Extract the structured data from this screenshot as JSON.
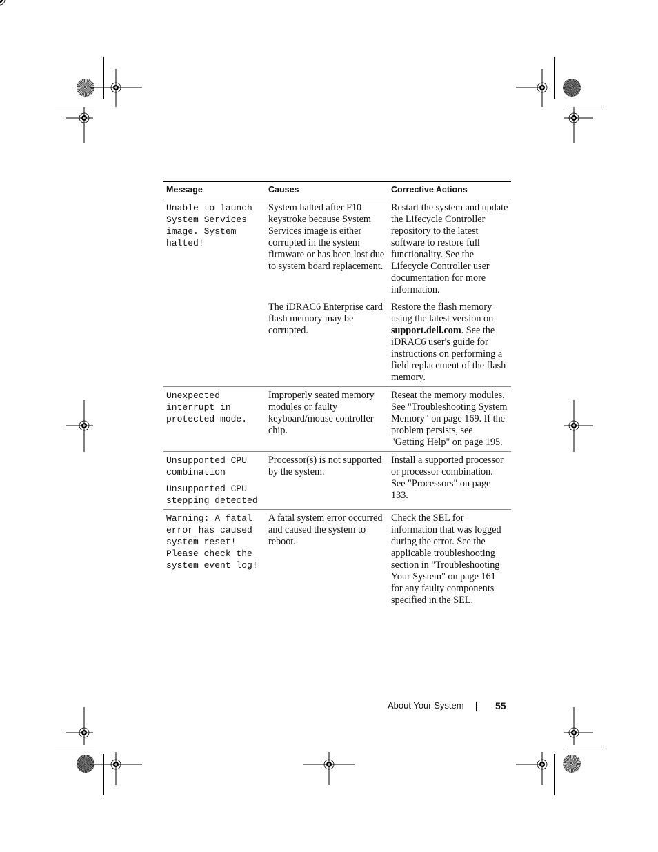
{
  "table": {
    "headers": [
      "Message",
      "Causes",
      "Corrective Actions"
    ],
    "rows": [
      {
        "message": [
          "Unable to launch System Services image. System halted!"
        ],
        "cause": "System halted after F10 keystroke because System Services image is either corrupted in the system firmware or has been lost due to system board replacement.",
        "action": "Restart the system and update the Lifecycle Controller repository to the latest software to restore full functionality. See the Lifecycle Controller user documentation for more information."
      },
      {
        "message": [],
        "cause": "The iDRAC6 Enterprise card flash memory may be corrupted.",
        "action_pre": "Restore the flash memory using the latest version on ",
        "action_link": "support.dell.com",
        "action_post": ". See the iDRAC6 user's guide for instructions on performing a field replacement of the flash memory."
      },
      {
        "message": [
          "Unexpected interrupt in protected mode."
        ],
        "cause": "Improperly seated memory modules or faulty keyboard/mouse controller chip.",
        "action": "Reseat the memory modules. See \"Troubleshooting System Memory\" on page 169. If the problem persists, see \"Getting Help\" on page 195."
      },
      {
        "message": [
          "Unsupported CPU combination",
          "Unsupported CPU stepping detected"
        ],
        "cause": "Processor(s) is not supported by the system.",
        "action": "Install a supported processor or processor combination. See \"Processors\" on page 133."
      },
      {
        "message": [
          "Warning: A fatal error has caused system reset! Please check the system event log!"
        ],
        "cause": "A fatal system error occurred and caused the system to reboot.",
        "action": "Check the SEL for information that was logged during the error. See the applicable troubleshooting section in \"Troubleshooting Your System\" on page 161 for any faulty components specified in the SEL."
      }
    ]
  },
  "footer": {
    "section": "About Your System",
    "page_number": "55"
  }
}
